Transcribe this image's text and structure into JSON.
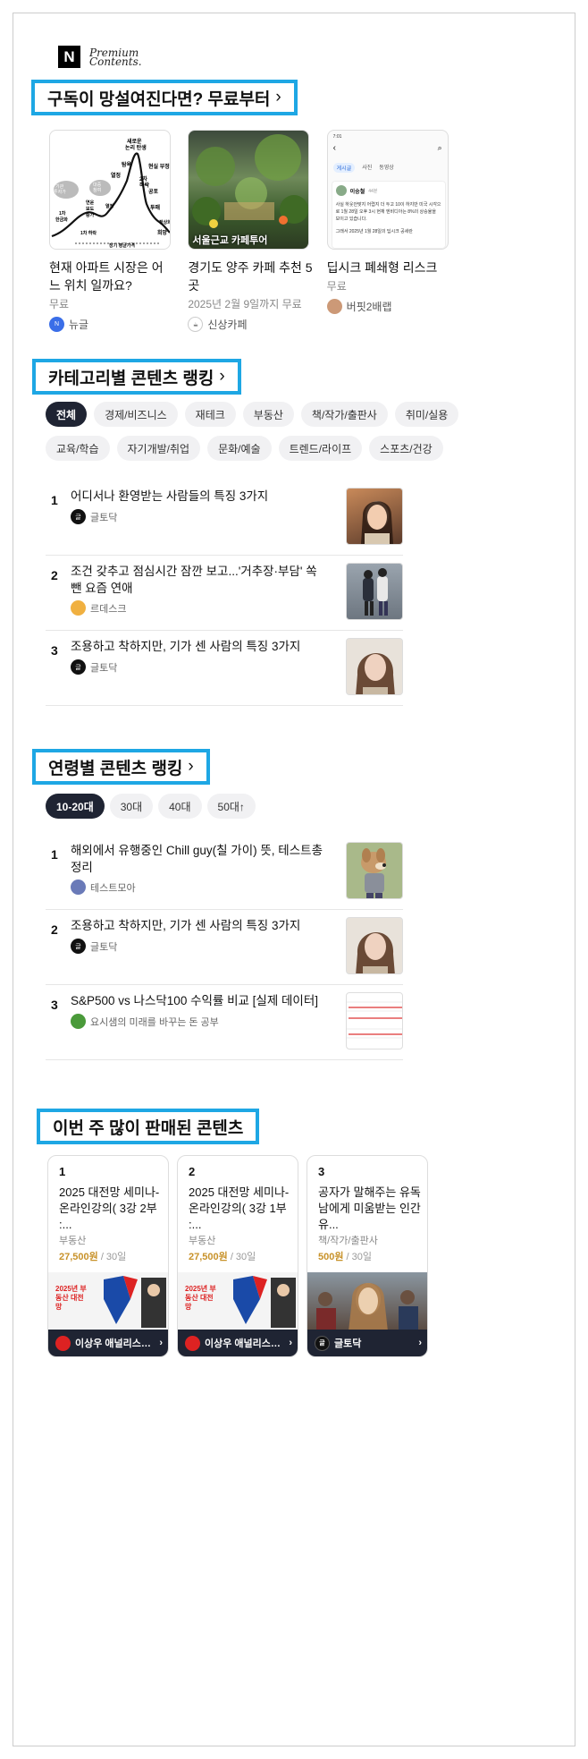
{
  "brand": {
    "n": "N",
    "premium_line1": "Premium",
    "premium_line2": "Contents."
  },
  "featured": {
    "title": "구독이 망설여진다면? 무료부터",
    "chevron": "›",
    "items": [
      {
        "title": "현재 아파트 시장은 어느 위치 일까요?",
        "sub": "무료",
        "author": "뉴글",
        "av_color": "#3a6ee8",
        "thumb_labels": [
          "새로운 논리 탄생",
          "대중 참여",
          "전문 투자가",
          "연운 보도 증가",
          "열정",
          "탐욕",
          "2차 하락",
          "현실 부정",
          "공포",
          "1차 하락",
          "장기 평균가격",
          "투매",
          "정상화",
          "희망",
          "1차 한금화",
          "기관 투자가"
        ]
      },
      {
        "title": "경기도 양주 카페 추천 5곳",
        "sub": "2025년 2월 9일까지 무료",
        "author": "신상카페",
        "av_color": "#888",
        "thumb_caption": "서울근교 카페투어"
      },
      {
        "title": "딥시크 폐쇄형 리스크",
        "sub": "무료",
        "author": "버핏2배랩",
        "av_color": "#b46",
        "phone": {
          "status": "7:01",
          "tabs": [
            "게시글",
            "사진",
            "동영상"
          ],
          "user": "이승철",
          "time": "44분",
          "body": "사실 하웃안맞지 어렵지 더 두고 10이 하지만 미국 시각으로 1월 28일 오후 3시 현재 엔비디아는 8%의 상승율을 보이고 있습니다.",
          "body2": "그래서 2025년 1월 28일의 딥시크 공세란"
        }
      }
    ]
  },
  "category": {
    "title": "카테고리별 콘텐츠 랭킹",
    "chevron": "›",
    "chips_row1": [
      "전체",
      "경제/비즈니스",
      "재테크",
      "부동산",
      "책/작가/출판사",
      "취미/실용"
    ],
    "chips_row2": [
      "교육/학습",
      "자기개발/취업",
      "문화/예술",
      "트렌드/라이프",
      "스포츠/건강"
    ],
    "items": [
      {
        "num": "1",
        "title": "어디서나 환영받는 사람들의 특징 3가지",
        "author": "글토닥"
      },
      {
        "num": "2",
        "title": "조건 갖추고 점심시간 잠깐 보고...'거추장·부담' 쏙 뺀 요즘 연애",
        "author": "르데스크"
      },
      {
        "num": "3",
        "title": "조용하고 착하지만, 기가 센 사람의 특징 3가지",
        "author": "글토닥"
      }
    ]
  },
  "age": {
    "title": "연령별 콘텐츠 랭킹",
    "chevron": "›",
    "chips": [
      "10-20대",
      "30대",
      "40대",
      "50대↑"
    ],
    "items": [
      {
        "num": "1",
        "title": "해외에서 유행중인 Chill guy(칠 가이) 뜻, 테스트총정리",
        "author": "테스트모아"
      },
      {
        "num": "2",
        "title": "조용하고 착하지만, 기가 센 사람의 특징 3가지",
        "author": "글토닥"
      },
      {
        "num": "3",
        "title": "S&P500 vs 나스닥100 수익률 비교 [실제 데이터]",
        "author": "요시샘의 미래를 바꾸는 돈 공부"
      }
    ]
  },
  "best": {
    "title": "이번 주 많이 판매된 콘텐츠",
    "items": [
      {
        "num": "1",
        "title": "2025 대전망 세미나- 온라인강의( 3강 2부 :...",
        "cat": "부동산",
        "price": "27,500원",
        "period": " / 30일",
        "channel": "이상우 애널리스트...",
        "badge": "2025년 부동산 대전망"
      },
      {
        "num": "2",
        "title": "2025 대전망 세미나- 온라인강의( 3강 1부 :...",
        "cat": "부동산",
        "price": "27,500원",
        "period": " / 30일",
        "channel": "이상우 애널리스트...",
        "badge": "2025년 부동산 대전망"
      },
      {
        "num": "3",
        "title": "공자가 말해주는 유독 남에게 미움받는 인간 유...",
        "cat": "책/작가/출판사",
        "price": "500원",
        "period": " / 30일",
        "channel": "글토닥"
      }
    ]
  },
  "colors": {
    "accent_border": "#1ea7e4",
    "chip_active": "#1f2433",
    "price": "#c8922a"
  }
}
